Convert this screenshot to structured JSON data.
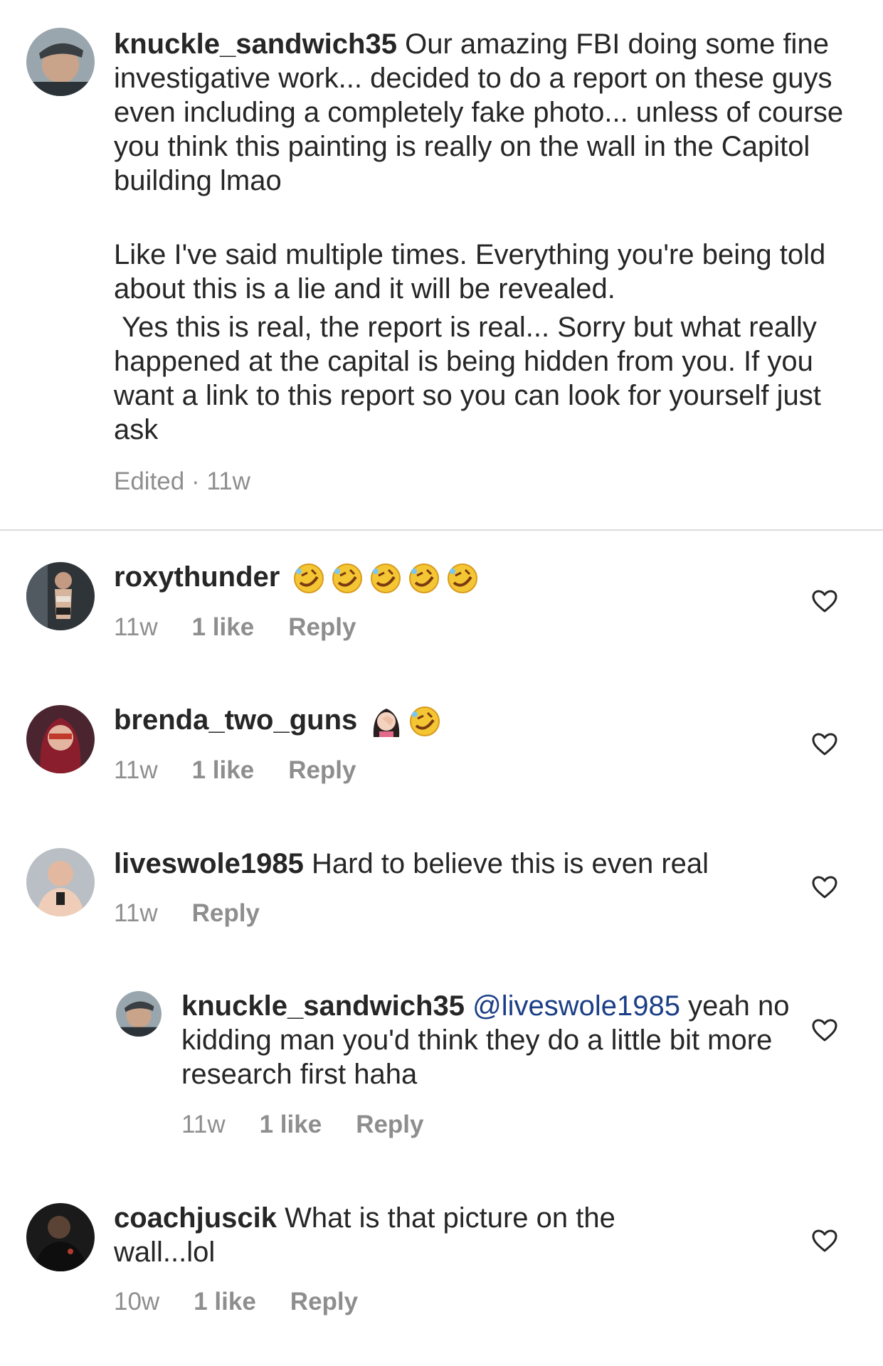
{
  "caption": {
    "username": "knuckle_sandwich35",
    "para1": "Our amazing FBI doing some fine investigative work... decided to do a report on these guys even including a completely fake photo... unless of course you think this painting is really on the wall in the Capitol building lmao",
    "para2": "Like I've said multiple times. Everything you're being told about this is a lie and it will be revealed.",
    "para3": " Yes this is real, the report is real... Sorry but what really happened at the capital is being hidden from you. If you want a link to this report so you can look for yourself just ask",
    "meta": "Edited · 11w"
  },
  "comments": [
    {
      "username": "roxythunder",
      "text": "",
      "emoji": [
        "rofl",
        "rofl",
        "rofl",
        "rofl",
        "rofl"
      ],
      "time": "11w",
      "likes": "1 like",
      "reply": "Reply"
    },
    {
      "username": "brenda_two_guns",
      "text": "",
      "emoji": [
        "facepalm",
        "rofl"
      ],
      "time": "11w",
      "likes": "1 like",
      "reply": "Reply"
    },
    {
      "username": "liveswole1985",
      "text": "Hard to believe this is even real",
      "time": "11w",
      "likes": "",
      "reply": "Reply"
    },
    {
      "username": "knuckle_sandwich35",
      "mention": "@liveswole1985",
      "text": "yeah no kidding man you'd think they do a little bit more research first haha",
      "time": "11w",
      "likes": "1 like",
      "reply": "Reply"
    },
    {
      "username": "coachjuscik",
      "text": "What is that picture on the wall...lol",
      "time": "10w",
      "likes": "1 like",
      "reply": "Reply"
    }
  ],
  "icons": {
    "like": "heart-outline-icon",
    "rofl": "rolling-on-floor-laughing-emoji",
    "facepalm": "woman-facepalming-emoji"
  }
}
